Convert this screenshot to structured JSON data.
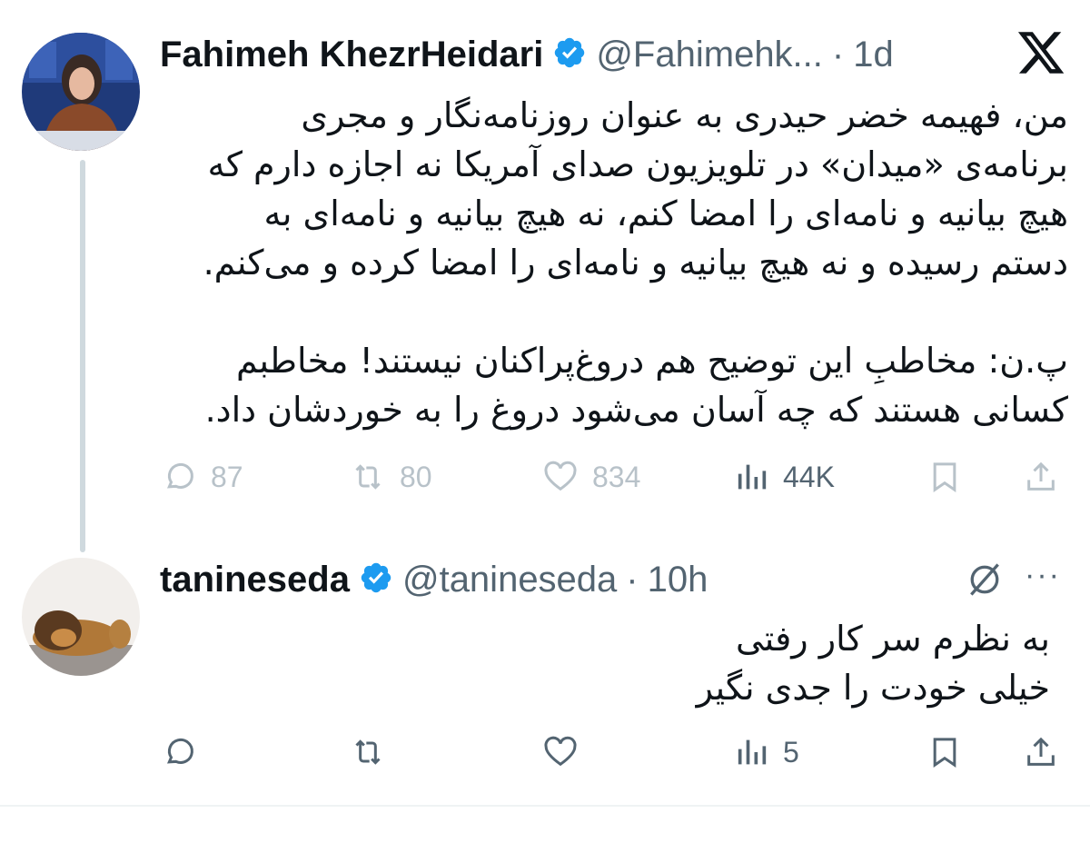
{
  "app": {
    "logo_icon": "x-logo-icon"
  },
  "tweet1": {
    "author_name": "Fahimeh KhezrHeidari",
    "handle": "@Fahimehk...",
    "separator": "·",
    "time": "1d",
    "verified_icon": "verified-badge-icon",
    "lines": [
      "من، فهیمه خضر حیدری به عنوان روزنامه‌نگار و مجری",
      "برنامه‌ی «میدان» در تلویزیون صدای آمریکا نه اجازه دارم که",
      "هیچ بیانیه و نامه‌ای را امضا کنم، نه هیچ بیانیه و نامه‌ای به",
      "دستم رسیده و نه هیچ بیانیه و نامه‌ای را امضا کرده و می‌کنم.",
      "پ.ن: مخاطبِ این توضیح هم دروغ‌پراکنان نیستند! مخاطبم",
      "کسانی هستند که چه آسان می‌شود دروغ را به خوردشان داد."
    ],
    "actions": {
      "replies": "87",
      "retweets": "80",
      "likes": "834",
      "views": "44K"
    }
  },
  "tweet2": {
    "author_name": "tanineseda",
    "handle": "@tanineseda",
    "separator": "·",
    "time": "10h",
    "more_label": "···",
    "lines": [
      "به نظرم سر کار رفتی",
      "خیلی خودت را جدی نگیر"
    ],
    "actions": {
      "views": "5"
    }
  },
  "colors": {
    "text": "#0f1419",
    "secondary": "#536471",
    "faded_actions": "#b8c2c9",
    "verified": "#1d9bf0",
    "thread_line": "#cfd9de"
  }
}
